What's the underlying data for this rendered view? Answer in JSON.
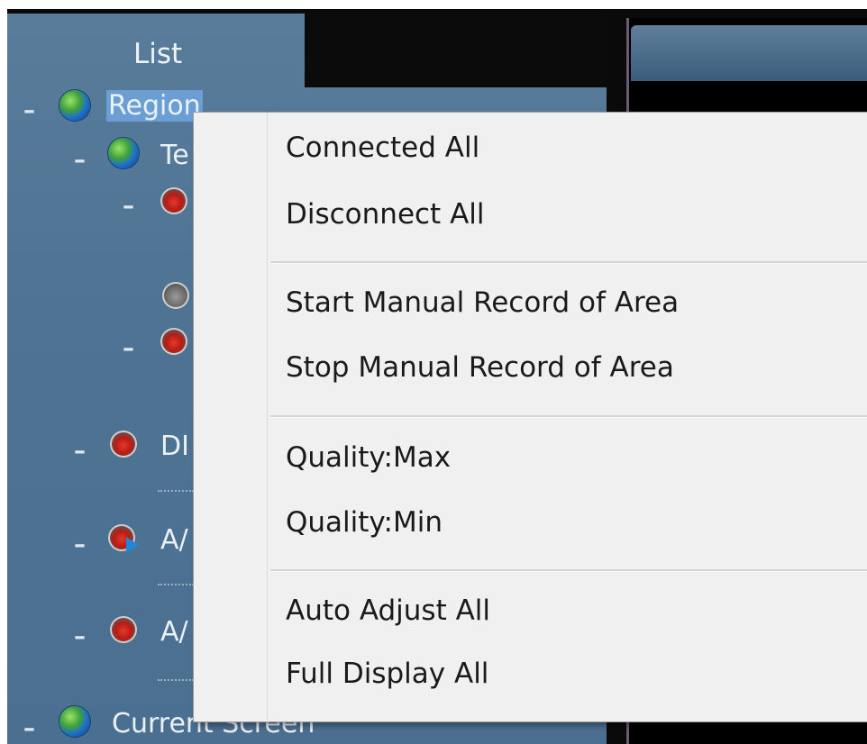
{
  "panel": {
    "title": "List",
    "tree": [
      {
        "label": "Region",
        "icon": "globe-icon",
        "selected": true
      },
      {
        "label": "Te",
        "icon": "globe-icon"
      },
      {
        "label": "DI",
        "icon": "camera-icon"
      },
      {
        "label": "A/",
        "icon": "camera-play-icon"
      },
      {
        "label": "A/",
        "icon": "camera-icon"
      },
      {
        "label": "Current Screen",
        "icon": "globe-icon"
      }
    ],
    "collapse_symbol": "–"
  },
  "context_menu": {
    "items": [
      "Connected All",
      "Disconnect All",
      "Start Manual Record of Area",
      "Stop Manual Record of Area",
      "Quality:Max",
      "Quality:Min",
      "Auto Adjust All",
      "Full Display All"
    ]
  },
  "colors": {
    "panel_bg": "#4f7393",
    "menu_bg": "#f0f0f0",
    "selection": "#6b9fd4"
  }
}
